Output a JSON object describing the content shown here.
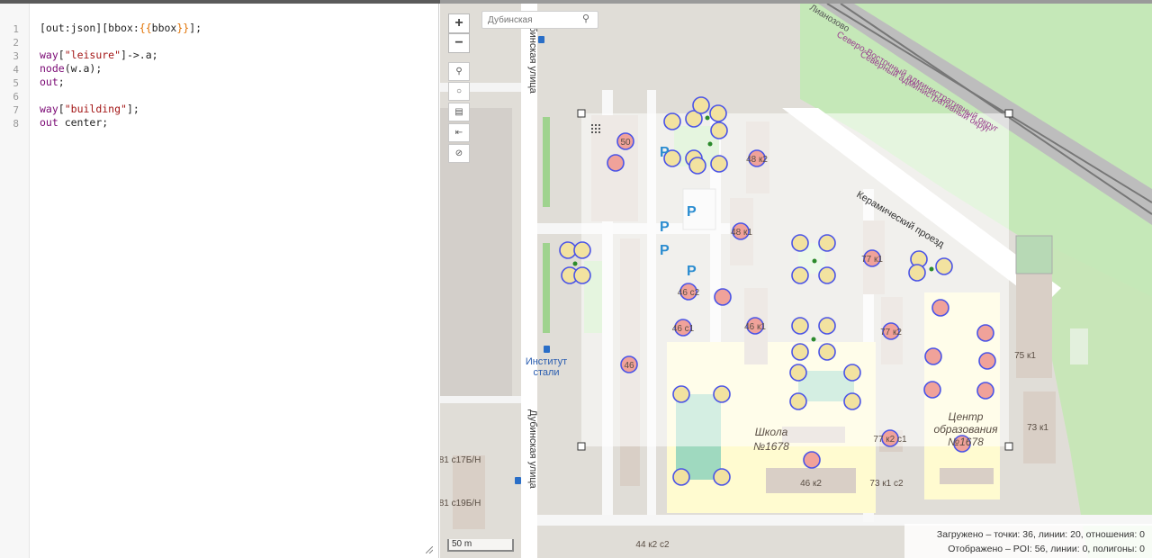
{
  "editor": {
    "line_numbers": [
      "1",
      "2",
      "3",
      "4",
      "5",
      "6",
      "7",
      "8"
    ]
  },
  "map": {
    "search_placeholder": "Дубинская",
    "zoom_in_label": "+",
    "zoom_out_label": "−",
    "scale_label": "50 m",
    "street_labels": {
      "dubininskaya_top": "Дубинская улица",
      "dubininskaya_bottom": "Дубинская улица",
      "keramichesky": "Керамический проезд",
      "okrug_1": "Северо-Восточный административный округ",
      "okrug_2": "Северный административный округ",
      "lianozovo": "Лианозово"
    },
    "poi_labels": {
      "institute_1": "Институт",
      "institute_2": "стали",
      "school_1": "Школа",
      "school_2": "№1678",
      "center_1": "Центр",
      "center_2": "образования",
      "center_3": "№1678"
    },
    "house_numbers": [
      "50",
      "48 к2",
      "48 к1",
      "46 с2",
      "46 с1",
      "46 к1",
      "46",
      "77 к1",
      "77 к2",
      "77 к2 с1",
      "46 к2",
      "73 к1 с2",
      "75 к1",
      "73 к1",
      "81 с17Б/Н",
      "81 с19Б/Н",
      "44 к2 с2"
    ],
    "parking_label": "P"
  },
  "status": {
    "loaded": "Загружено – точки: 36, линии: 20, отношения: 0",
    "displayed": "Отображено – POI: 56, линии: 0, полигоны: 0"
  },
  "colors": {
    "road": "#ffffff",
    "park": "#c5e8b8",
    "school": "#fffbd0",
    "building": "#d9cfc6",
    "marker_fill": "#f2c3a8",
    "marker_stroke": "#4b54e6",
    "selection": "rgba(255,255,255,0.62)"
  }
}
